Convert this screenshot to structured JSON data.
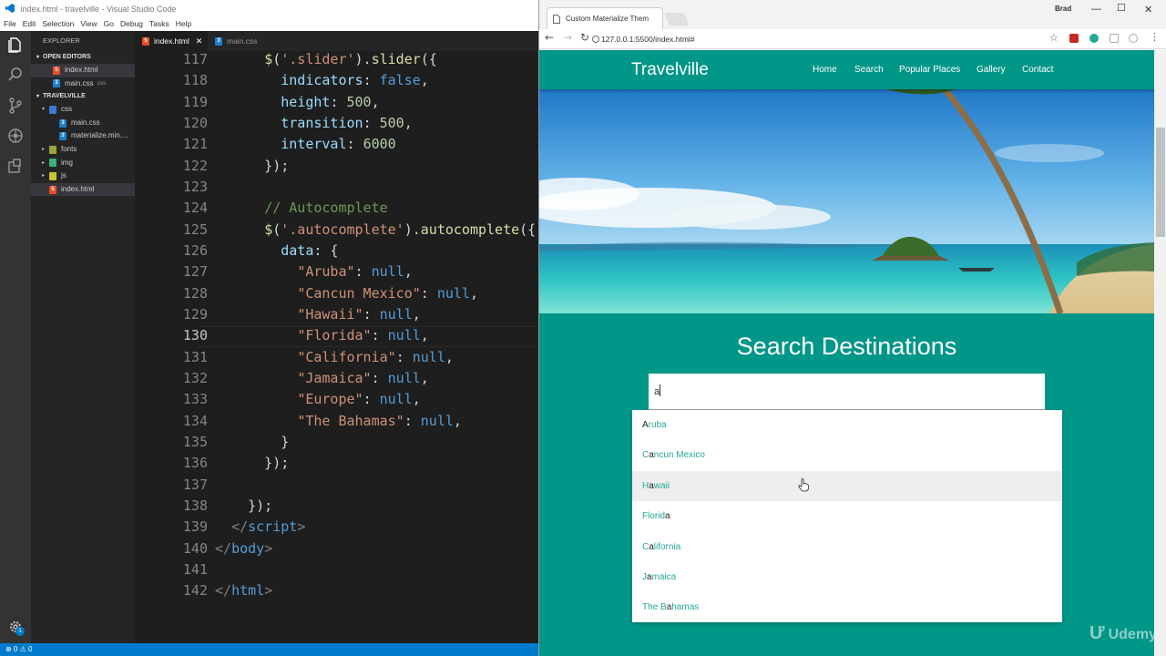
{
  "vscode": {
    "title": "index.html - travelville - Visual Studio Code",
    "menu": [
      "File",
      "Edit",
      "Selection",
      "View",
      "Go",
      "Debug",
      "Tasks",
      "Help"
    ],
    "explorer_label": "EXPLORER",
    "open_editors_label": "OPEN EDITORS",
    "open_editors": [
      {
        "name": "index.html",
        "type": "html",
        "sub": ""
      },
      {
        "name": "main.css",
        "type": "css",
        "sub": "css"
      }
    ],
    "project_label": "TRAVELVILLE",
    "tree": [
      {
        "name": "css",
        "kind": "cssfold",
        "indent": 1,
        "caret": "▾"
      },
      {
        "name": "main.css",
        "kind": "css",
        "indent": 2,
        "caret": ""
      },
      {
        "name": "materialize.min....",
        "kind": "css",
        "indent": 2,
        "caret": ""
      },
      {
        "name": "fonts",
        "kind": "fold",
        "indent": 1,
        "caret": "▸"
      },
      {
        "name": "img",
        "kind": "imgfold",
        "indent": 1,
        "caret": "▸"
      },
      {
        "name": "js",
        "kind": "jsfold",
        "indent": 1,
        "caret": "▸"
      },
      {
        "name": "index.html",
        "kind": "html",
        "indent": 1,
        "caret": ""
      }
    ],
    "tabs": [
      {
        "label": "index.html",
        "active": true
      },
      {
        "label": "main.css",
        "active": false
      }
    ],
    "line_numbers": [
      "117",
      "118",
      "119",
      "120",
      "121",
      "122",
      "123",
      "124",
      "125",
      "126",
      "127",
      "128",
      "129",
      "130",
      "131",
      "132",
      "133",
      "134",
      "135",
      "136",
      "137",
      "138",
      "139",
      "140",
      "141",
      "142"
    ],
    "status": "⊗ 0 ⚠ 0",
    "badge": "1"
  },
  "browser": {
    "tab_title": "Custom Materialize Them",
    "url": "127.0.0.1:5500/index.html#",
    "profile": "Brad",
    "site": {
      "brand": "Travelville",
      "nav": [
        "Home",
        "Search",
        "Popular Places",
        "Gallery",
        "Contact"
      ],
      "heading": "Search Destinations",
      "search_value": "a",
      "suggestions": [
        {
          "pre": "",
          "match": "A",
          "post": "ruba"
        },
        {
          "pre": "C",
          "match": "a",
          "post": "ncun Mexico"
        },
        {
          "pre": "H",
          "match": "a",
          "post": "waii"
        },
        {
          "pre": "Florid",
          "match": "a",
          "post": ""
        },
        {
          "pre": "C",
          "match": "a",
          "post": "lifornia"
        },
        {
          "pre": "J",
          "match": "a",
          "post": "maica"
        },
        {
          "pre": "The B",
          "match": "a",
          "post": "hamas"
        }
      ]
    }
  },
  "watermark": "Udemy"
}
